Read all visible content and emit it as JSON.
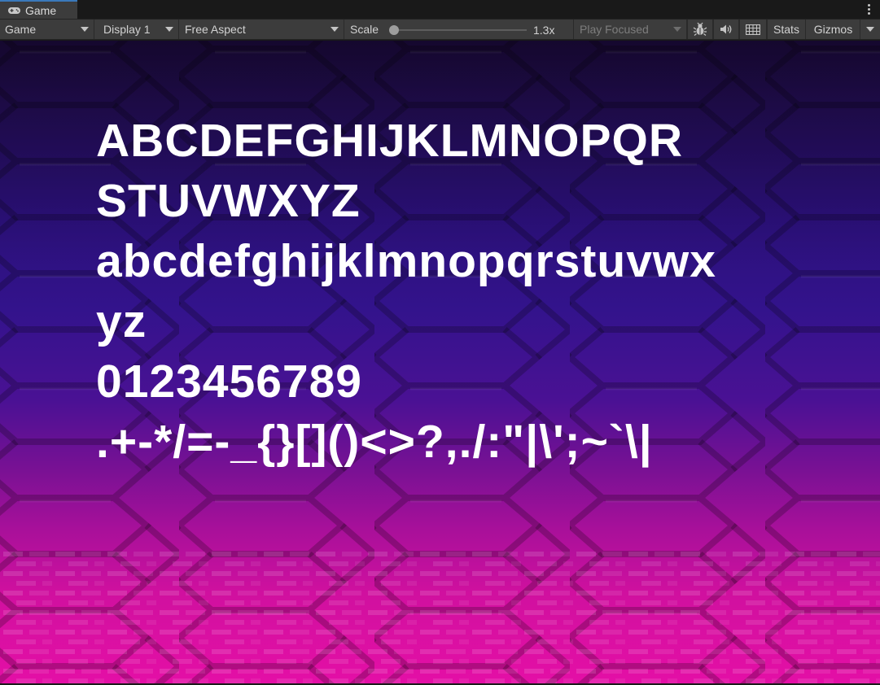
{
  "window": {
    "tab_title": "Game",
    "tab_icon": "gamepad-icon",
    "menu_icon": "kebab-menu-icon"
  },
  "toolbar": {
    "view_mode": "Game",
    "display": "Display 1",
    "aspect": "Free Aspect",
    "scale_label": "Scale",
    "scale_value": "1.3x",
    "play_mode": "Play Focused",
    "stats_label": "Stats",
    "gizmos_label": "Gizmos",
    "icons": [
      "bug-icon",
      "audio-icon",
      "grid-icon"
    ]
  },
  "game_view": {
    "text_lines": [
      "ABCDEFGHIJKLMNOPQR",
      "STUVWXYZ",
      "abcdefghijklmnopqrstuvwx",
      "yz",
      "0123456789",
      ".+-*/=-_{}[]()<>?,./:\"|\\';~`\\|"
    ],
    "colors": {
      "top": "#1c0a3d",
      "middle": "#33138c",
      "bottom": "#e40fa6",
      "text": "#ffffff"
    }
  }
}
